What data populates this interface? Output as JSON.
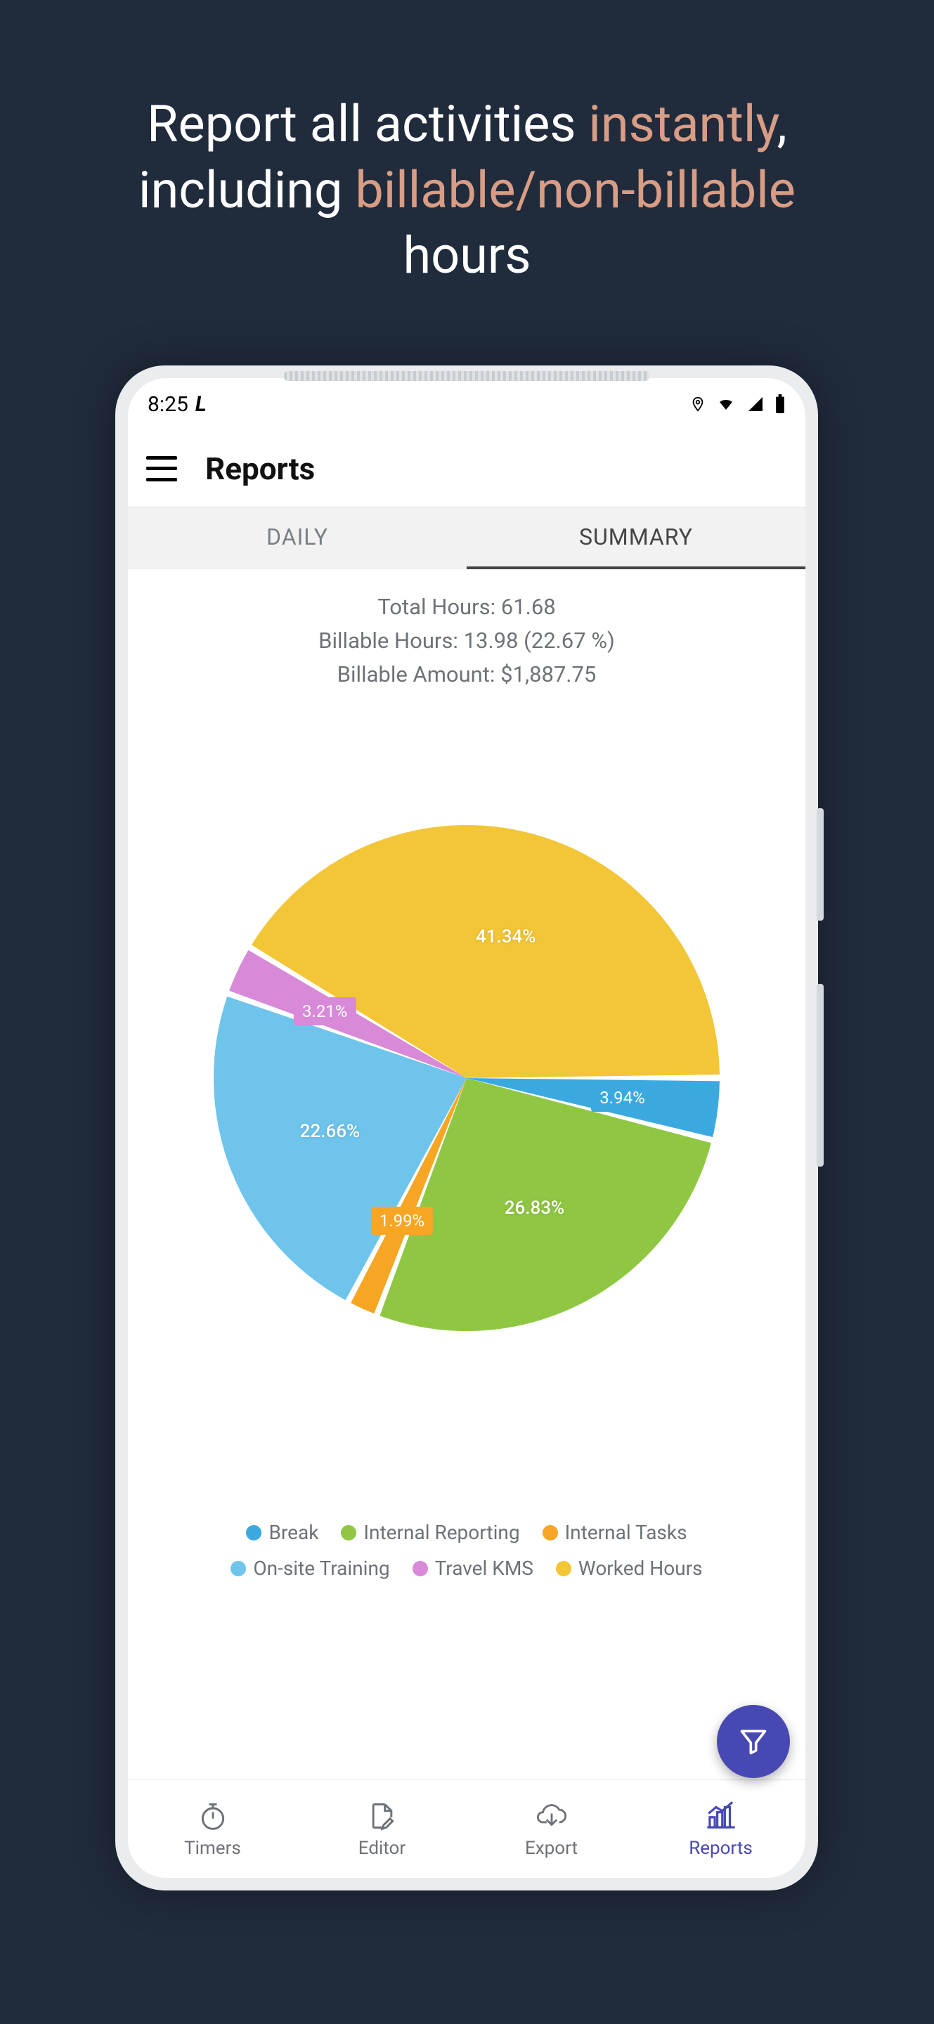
{
  "promo": {
    "p1": "Report all activities ",
    "accent1": "instantly",
    "p2": ", including ",
    "accent2": "billable/non-billable",
    "p3": " hours"
  },
  "status": {
    "time": "8:25"
  },
  "app": {
    "title": "Reports"
  },
  "tabs": {
    "daily": "DAILY",
    "summary": "SUMMARY",
    "active": "summary"
  },
  "stats": {
    "line1": "Total Hours: 61.68",
    "line2": "Billable Hours: 13.98 (22.67 %)",
    "line3": "Billable Amount: $1,887.75"
  },
  "chart_data": {
    "type": "pie",
    "title": "",
    "series": [
      {
        "name": "Break",
        "value": 3.94,
        "color": "#3ba9e0",
        "label": "3.94%"
      },
      {
        "name": "Internal Reporting",
        "value": 26.83,
        "color": "#8fc742",
        "label": "26.83%"
      },
      {
        "name": "Internal Tasks",
        "value": 1.99,
        "color": "#f6a623",
        "label": "1.99%"
      },
      {
        "name": "On-site Training",
        "value": 22.66,
        "color": "#6ec4eb",
        "label": "22.66%"
      },
      {
        "name": "Travel KMS",
        "value": 3.21,
        "color": "#d889d8",
        "label": "3.21%"
      },
      {
        "name": "Worked Hours",
        "value": 41.34,
        "color": "#f2c636",
        "label": "41.34%"
      }
    ]
  },
  "nav": {
    "timers": "Timers",
    "editor": "Editor",
    "export": "Export",
    "reports": "Reports",
    "active": "reports"
  }
}
